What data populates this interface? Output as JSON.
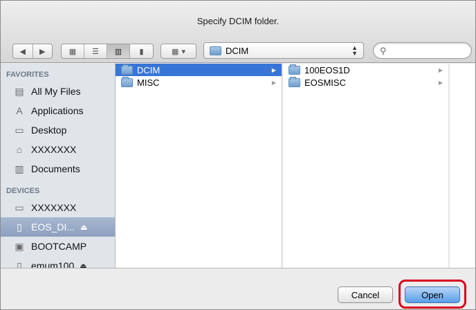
{
  "window": {
    "title": "Specify DCIM folder."
  },
  "toolbar": {
    "back_icon": "triangle-left",
    "forward_icon": "triangle-right",
    "view_icons": [
      "icon-view",
      "list-view",
      "column-view",
      "coverflow-view"
    ],
    "arrange_icon": "arrange-grid",
    "arrange_dropdown": "▾",
    "path": {
      "label": "DCIM",
      "arrows_up": "▲",
      "arrows_down": "▼"
    },
    "search": {
      "placeholder": "",
      "icon": "⚲"
    }
  },
  "sidebar": {
    "favorites_title": "FAVORITES",
    "favorites": [
      {
        "label": "All My Files",
        "icon": "▤"
      },
      {
        "label": "Applications",
        "icon": "A"
      },
      {
        "label": "Desktop",
        "icon": "▭"
      },
      {
        "label": "XXXXXXX",
        "icon": "⌂"
      },
      {
        "label": "Documents",
        "icon": "▥"
      }
    ],
    "devices_title": "DEVICES",
    "devices": [
      {
        "label": "XXXXXXX",
        "icon": "▭"
      },
      {
        "label": "EOS_DI...",
        "icon": "▯",
        "eject": "⏏",
        "selected": true
      },
      {
        "label": "BOOTCAMP",
        "icon": "▣"
      },
      {
        "label": "emum100",
        "icon": "▯",
        "eject": "⏏"
      }
    ]
  },
  "columns": {
    "col1": [
      {
        "label": "DCIM",
        "selected": true,
        "chevron": "▶"
      },
      {
        "label": "MISC",
        "selected": false,
        "chevron": "▶"
      }
    ],
    "col2": [
      {
        "label": "100EOS1D",
        "chevron": "▶"
      },
      {
        "label": "EOSMISC",
        "chevron": "▶"
      }
    ]
  },
  "footer": {
    "cancel_label": "Cancel",
    "open_label": "Open"
  },
  "colors": {
    "selection": "#3875d7",
    "highlight": "#d6001c",
    "sidebar": "#e0e5ea"
  }
}
